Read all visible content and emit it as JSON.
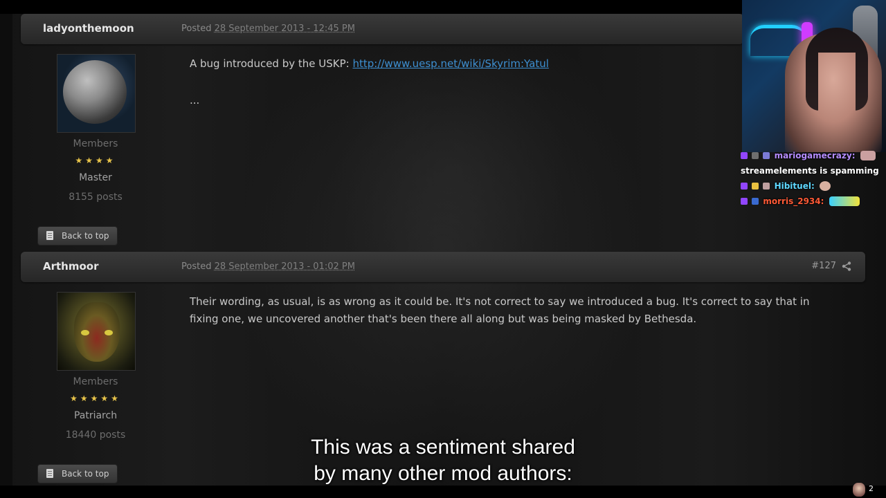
{
  "posts": [
    {
      "username": "ladyonthemoon",
      "posted_prefix": "Posted",
      "date": "28 September 2013 - 12:45 PM",
      "group": "Members",
      "stars": "★★★★",
      "rank": "Master",
      "post_count": "8155 posts",
      "body_prefix": "A bug introduced by the USKP:",
      "link": "http://www.uesp.net/wiki/Skyrim:Yatul",
      "ellipsis": "...",
      "back_to_top": "Back to top"
    },
    {
      "username": "Arthmoor",
      "posted_prefix": "Posted",
      "date": "28 September 2013 - 01:02 PM",
      "post_number": "#127",
      "group": "Members",
      "stars": "★★★★★",
      "rank": "Patriarch",
      "post_count": "18440 posts",
      "body_line1": "Their wording, as usual, is as wrong as it could be. It's not correct to say we introduced a bug. It's correct to say that in",
      "body_line2": "fixing one, we uncovered another that's been there all along but was being masked by Bethesda.",
      "back_to_top": "Back to top"
    }
  ],
  "chat": [
    {
      "user": "mariogamecrazy:",
      "user_color": "#b58cff",
      "message": "streamelements is spamming"
    },
    {
      "user": "Hibituel:",
      "user_color": "#5fd8ff",
      "message": ""
    },
    {
      "user": "morris_2934:",
      "user_color": "#ff5a36",
      "message": ""
    }
  ],
  "subtitle": {
    "line1": "This was a sentiment shared",
    "line2": "by many other mod authors:"
  },
  "viewer_count": "2",
  "colors": {
    "link": "#3d8fd1",
    "star": "#e8c44a",
    "header_bg": "#2f2f2f"
  }
}
